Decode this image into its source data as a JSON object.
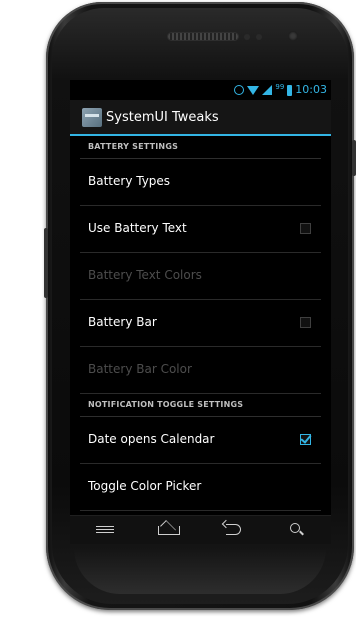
{
  "status_bar": {
    "time": "10:03",
    "battery_level": "99"
  },
  "action_bar": {
    "title": "SystemUI Tweaks"
  },
  "sections": [
    {
      "header": "BATTERY SETTINGS",
      "items": [
        {
          "label": "Battery Types",
          "enabled": true,
          "checkbox": null
        },
        {
          "label": "Use Battery Text",
          "enabled": true,
          "checkbox": false
        },
        {
          "label": "Battery Text Colors",
          "enabled": false,
          "checkbox": null
        },
        {
          "label": "Battery Bar",
          "enabled": true,
          "checkbox": false
        },
        {
          "label": "Battery Bar Color",
          "enabled": false,
          "checkbox": null
        }
      ]
    },
    {
      "header": "NOTIFICATION TOGGLE SETTINGS",
      "items": [
        {
          "label": "Date opens Calendar",
          "enabled": true,
          "checkbox": true
        },
        {
          "label": "Toggle Color Picker",
          "enabled": true,
          "checkbox": null
        }
      ]
    }
  ],
  "nav_bar": {
    "icons": [
      "menu-icon",
      "home-icon",
      "back-icon",
      "search-icon"
    ]
  },
  "colors": {
    "accent": "#33b5e5",
    "background": "#000000",
    "disabled_text": "#4d4d4d"
  }
}
